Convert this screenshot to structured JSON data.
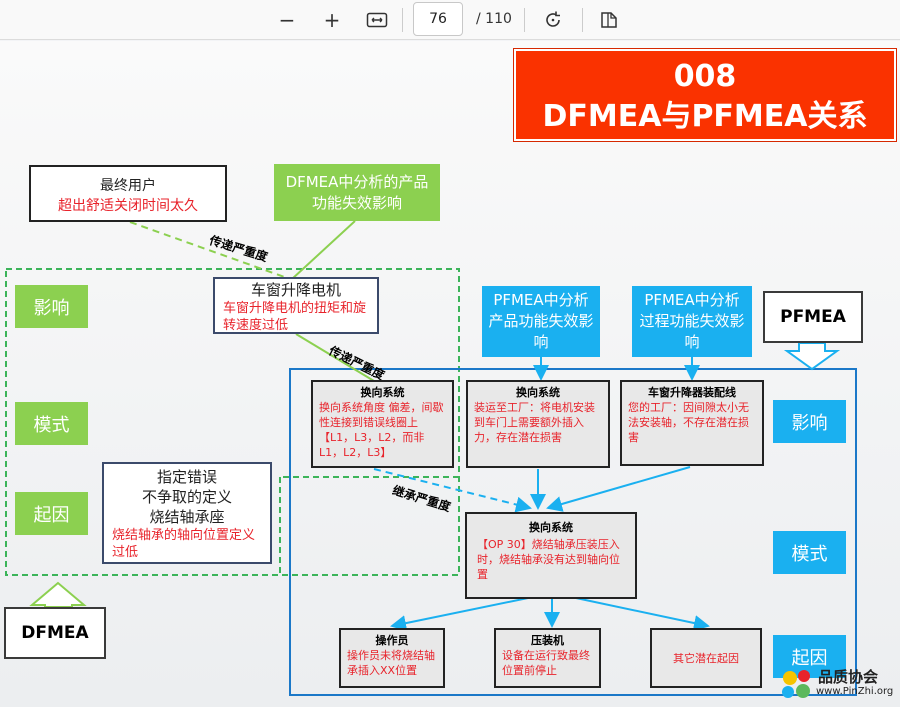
{
  "toolbar": {
    "zoom_out": "−",
    "zoom_in": "+",
    "current_page": "76",
    "total_pages": "/ 110"
  },
  "title": {
    "number": "008",
    "text": "DFMEA与PFMEA关系"
  },
  "end_user": {
    "line1": "最终用户",
    "line2": "超出舒适关闭时间太久"
  },
  "dfmea_effect_box": "DFMEA中分析的产品功能失效影响",
  "propagate_label_1": "传递严重度",
  "propagate_label_2": "传递严重度",
  "inherit_label": "继承严重度",
  "motor": {
    "title": "车窗升降电机",
    "desc": "车窗升降电机的扭矩和旋转速度过低"
  },
  "dfmea_labels": {
    "effect": "影响",
    "mode": "模式",
    "cause": "起因"
  },
  "cause_box": {
    "line1": "指定错误",
    "line2": "不争取的定义",
    "line3": "烧结轴承座",
    "desc": "烧结轴承的轴向位置定义过低"
  },
  "dfmea_tag": "DFMEA",
  "pfmea_tag": "PFMEA",
  "pfmea_product_box": "PFMEA中分析产品功能失效影响",
  "pfmea_process_box": "PFMEA中分析过程功能失效影响",
  "pfmea_labels": {
    "effect": "影响",
    "mode": "模式",
    "cause": "起因"
  },
  "effects": [
    {
      "title": "换向系统",
      "desc": "换向系统角度 偏差，间歇性连接到错误线圈上【L1，L3，L2，而非L1，L2，L3】"
    },
    {
      "title": "换向系统",
      "desc": "装运至工厂：将电机安装到车门上需要额外插入力，存在潜在损害"
    },
    {
      "title": "车窗升降器装配线",
      "desc": "您的工厂：因间隙太小无法安装轴，不存在潜在损害"
    }
  ],
  "mode_box": {
    "title": "换向系统",
    "desc": "【OP 30】烧结轴承压装压入时，烧结轴承没有达到轴向位置"
  },
  "causes": [
    {
      "title": "操作员",
      "desc": "操作员未将烧结轴承插入XX位置"
    },
    {
      "title": "压装机",
      "desc": "设备在运行致最终位置前停止"
    },
    {
      "title": "",
      "desc": "其它潜在起因"
    }
  ],
  "watermark": {
    "name": "品质协会",
    "url": "www.PinZhi.org"
  }
}
